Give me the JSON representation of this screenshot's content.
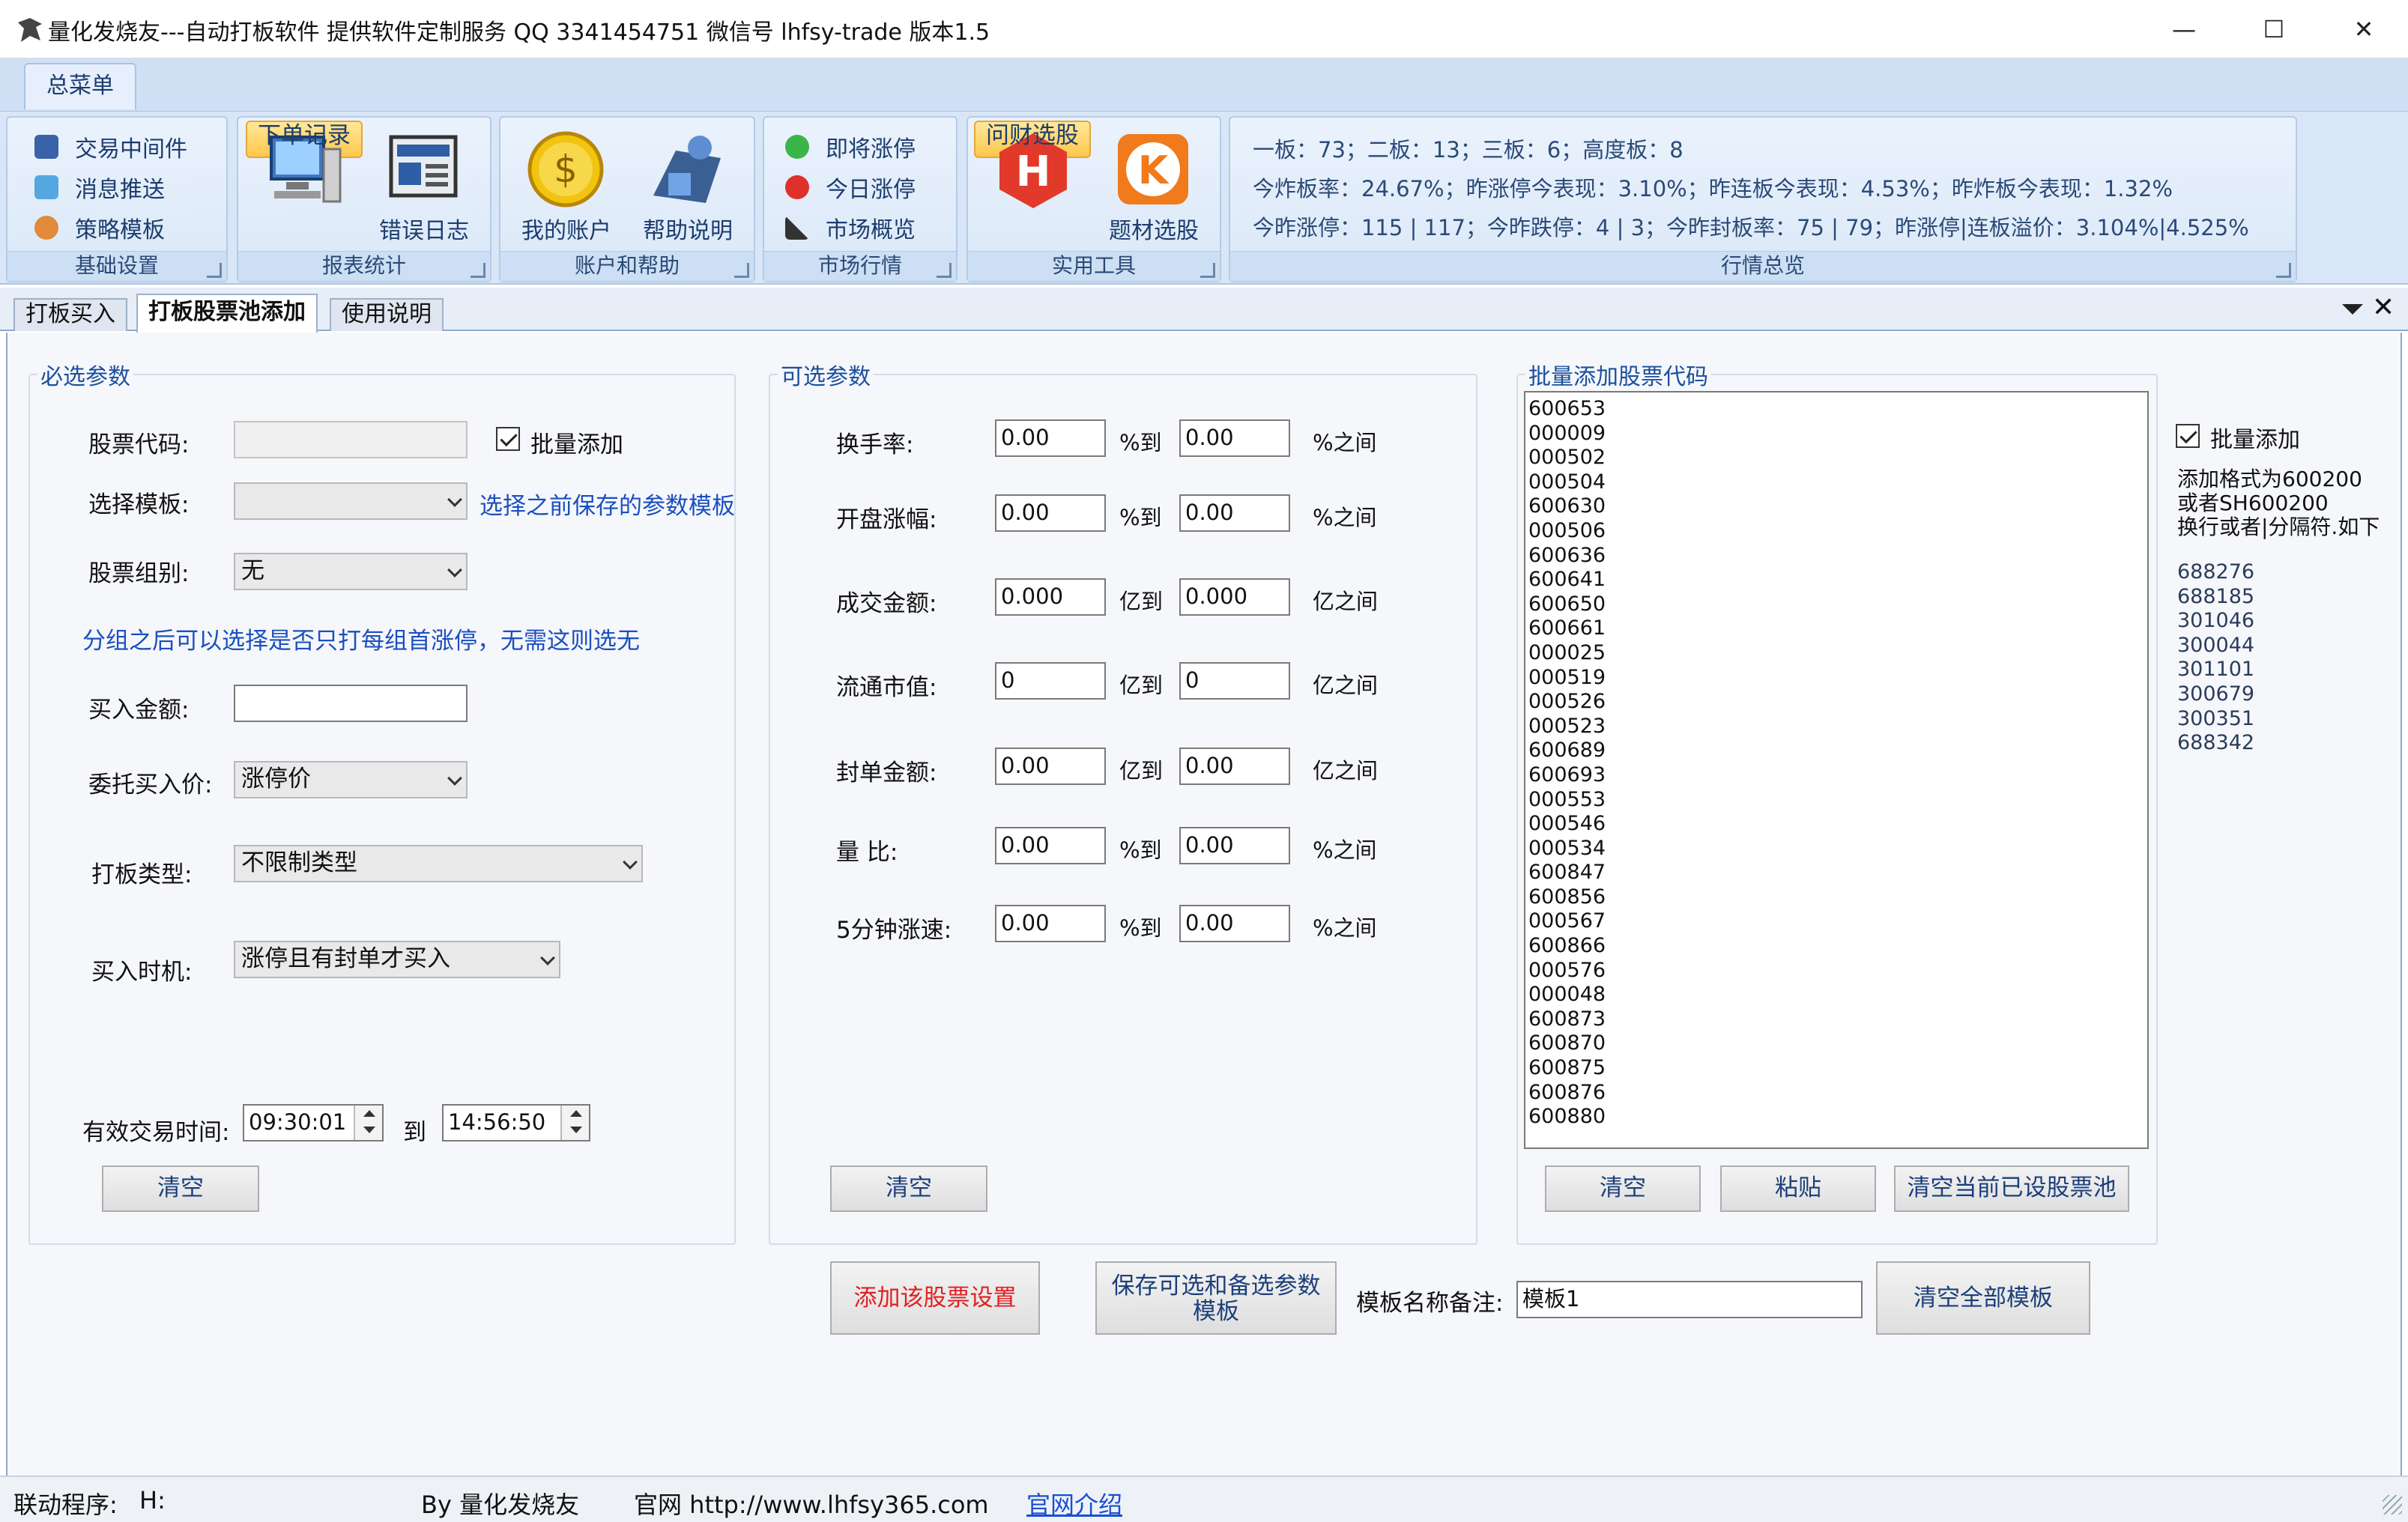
{
  "window": {
    "title": "量化发烧友---自动打板软件 提供软件定制服务 QQ 3341454751 微信号 lhfsy-trade  版本1.5",
    "minimize": "—",
    "maximize": "☐",
    "close": "✕"
  },
  "menu": {
    "tab": "总菜单"
  },
  "ribbon": {
    "groups": {
      "basic": {
        "caption": "基础设置",
        "items": [
          "交易中间件",
          "消息推送",
          "策略模板"
        ]
      },
      "report": {
        "caption": "报表统计",
        "order_log": "下单记录",
        "error_log": "错误日志"
      },
      "account": {
        "caption": "账户和帮助",
        "my_account": "我的账户",
        "help": "帮助说明"
      },
      "market": {
        "caption": "市场行情",
        "items": [
          "即将涨停",
          "今日涨停",
          "市场概览"
        ]
      },
      "tools": {
        "caption": "实用工具",
        "wencai": "问财选股",
        "theme": "题材选股"
      },
      "overview": {
        "caption": "行情总览",
        "line1": "一板：73；二板：13；三板：6；高度板：8",
        "line2": "今炸板率：24.67%；昨涨停今表现：3.10%；昨连板今表现：4.53%；昨炸板今表现：1.32%",
        "line3": "今昨涨停：115 | 117；今昨跌停：4 | 3；今昨封板率：75 | 79；昨涨停|连板溢价：3.104%|4.525%"
      }
    }
  },
  "tabs": [
    "打板买入",
    "打板股票池添加",
    "使用说明"
  ],
  "required": {
    "legend": "必选参数",
    "stock_code_label": "股票代码:",
    "batch_add_label": "批量添加",
    "template_label": "选择模板:",
    "template_hint": "选择之前保存的参数模板",
    "group_label": "股票组别:",
    "group_value": "无",
    "group_hint": "分组之后可以选择是否只打每组首涨停，无需这则选无",
    "amount_label": "买入金额:",
    "price_label": "委托买入价:",
    "price_value": "涨停价",
    "type_label": "打板类型:",
    "type_value": "不限制类型",
    "timing_label": "买入时机:",
    "timing_value": "涨停且有封单才买入",
    "time_label": "有效交易时间:",
    "time_from": "09:30:01",
    "time_to_label": "到",
    "time_to": "14:56:50",
    "clear": "清空"
  },
  "optional": {
    "legend": "可选参数",
    "rows": [
      {
        "label": "换手率:",
        "from": "0.00",
        "mid": "%到",
        "to": "0.00",
        "end": "%之间"
      },
      {
        "label": "开盘涨幅:",
        "from": "0.00",
        "mid": "%到",
        "to": "0.00",
        "end": "%之间"
      },
      {
        "label": "成交金额:",
        "from": "0.000",
        "mid": "亿到",
        "to": "0.000",
        "end": "亿之间"
      },
      {
        "label": "流通市值:",
        "from": "0",
        "mid": "亿到",
        "to": "0",
        "end": "亿之间"
      },
      {
        "label": "封单金额:",
        "from": "0.00",
        "mid": "亿到",
        "to": "0.00",
        "end": "亿之间"
      },
      {
        "label": "量 比:",
        "from": "0.00",
        "mid": "%到",
        "to": "0.00",
        "end": "%之间"
      },
      {
        "label": "5分钟涨速:",
        "from": "0.00",
        "mid": "%到",
        "to": "0.00",
        "end": "%之间"
      }
    ],
    "clear": "清空"
  },
  "batch": {
    "legend": "批量添加股票代码",
    "codes": [
      "600653",
      "000009",
      "000502",
      "000504",
      "600630",
      "000506",
      "600636",
      "600641",
      "600650",
      "600661",
      "000025",
      "000519",
      "000526",
      "000523",
      "600689",
      "600693",
      "000553",
      "000546",
      "000534",
      "600847",
      "600856",
      "000567",
      "600866",
      "000576",
      "000048",
      "600873",
      "600870",
      "600875",
      "600876",
      "600880"
    ],
    "clear": "清空",
    "paste": "粘贴",
    "clear_pool": "清空当前已设股票池",
    "batch_check_label": "批量添加",
    "format_hint1": "添加格式为600200",
    "format_hint2": "或者SH600200",
    "format_hint3": "换行或者|分隔符.如下",
    "examples": [
      "688276",
      "688185",
      "301046",
      "300044",
      "301101",
      "300679",
      "300351",
      "688342"
    ]
  },
  "bottom": {
    "add_setting": "添加该股票设置",
    "save_template_l1": "保存可选和备选参数",
    "save_template_l2": "模板",
    "template_name_label": "模板名称备注:",
    "template_name_value": "模板1",
    "clear_all_templates": "清空全部模板"
  },
  "status": {
    "link_program": "联动程序:",
    "link_value": "H:",
    "by": "By 量化发烧友",
    "site_label": "官网 http://www.lhfsy365.com",
    "site_intro": "官网介绍"
  },
  "colors": {
    "accent": "#1b4fbf",
    "ribbon_bg": "#d8e6f7",
    "add_button_text": "#e02020"
  }
}
